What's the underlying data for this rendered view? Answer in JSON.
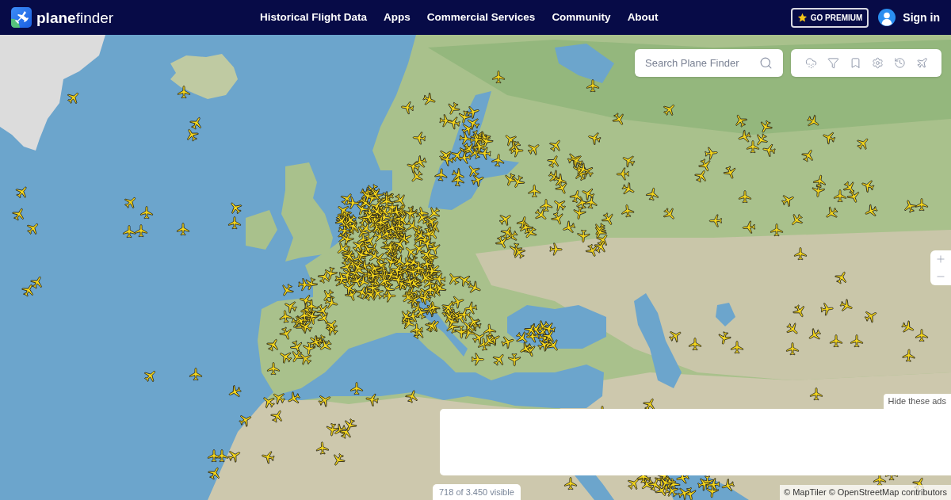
{
  "header": {
    "brand": "**plane**finder",
    "nav": [
      {
        "label": "Historical Flight Data"
      },
      {
        "label": "Apps"
      },
      {
        "label": "Commercial Services"
      },
      {
        "label": "Community"
      },
      {
        "label": "About"
      }
    ],
    "premium_button": "GO PREMIUM",
    "sign_in": "Sign in"
  },
  "map": {
    "search": {
      "placeholder": "Search Plane Finder"
    },
    "hide_ads": "Hide these ads",
    "visible_count": "718 of 3.450 visible",
    "attribution": "© MapTiler © OpenStreetMap contributors"
  }
}
